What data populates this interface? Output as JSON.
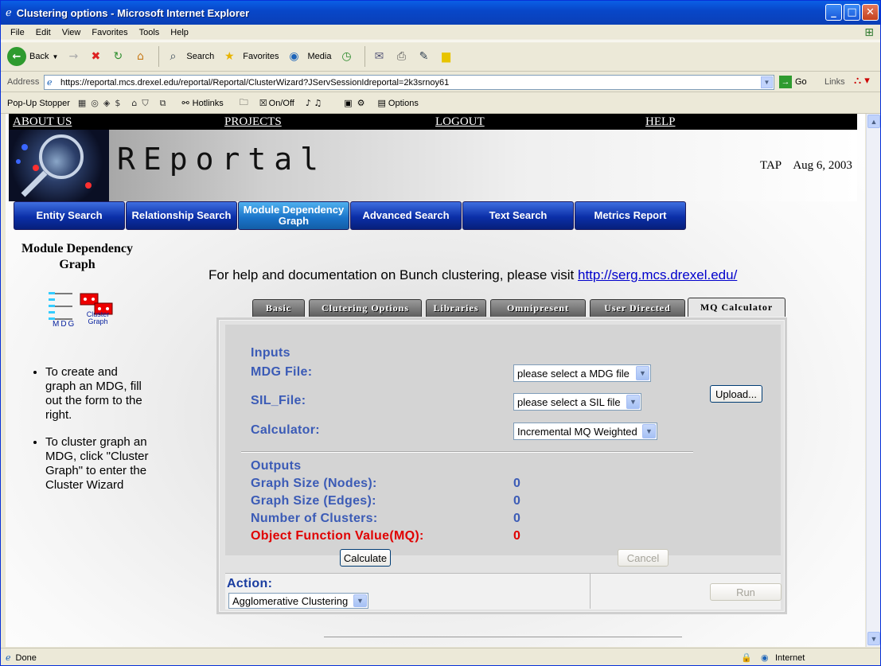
{
  "window": {
    "title": "Clustering options - Microsoft Internet Explorer",
    "controls": {
      "minimize": "_",
      "maximize": "□",
      "close": "✕"
    }
  },
  "menubar": {
    "items": [
      "File",
      "Edit",
      "View",
      "Favorites",
      "Tools",
      "Help"
    ]
  },
  "toolbar": {
    "back": "Back",
    "search": "Search",
    "favorites": "Favorites",
    "media": "Media"
  },
  "addressbar": {
    "label": "Address",
    "url": "https://reportal.mcs.drexel.edu/reportal/Reportal/ClusterWizard?JServSessionIdreportal=2k3srnoy61",
    "go": "Go",
    "links": "Links"
  },
  "popupbar": {
    "label": "Pop-Up Stopper",
    "hotlinks": "Hotlinks",
    "onoff": "On/Off",
    "options": "Options"
  },
  "page": {
    "topnav": [
      "ABOUT US",
      "PROJECTS",
      "LOGOUT",
      "HELP"
    ],
    "brand": "REportal",
    "user": "TAP",
    "date": "Aug 6, 2003",
    "nav_buttons": [
      "Entity Search",
      "Relationship Search",
      "Module Dependency Graph",
      "Advanced Search",
      "Text Search",
      "Metrics Report"
    ],
    "active_nav": "Module Dependency Graph",
    "sidebar": {
      "title": "Module Dependency Graph",
      "icon_labels": [
        "MDG",
        "Cluster Graph"
      ],
      "bullets": [
        "To create and graph an MDG, fill out the form to the right.",
        "To cluster graph an MDG, click \"Cluster Graph\" to enter the Cluster Wizard"
      ]
    },
    "help_text": "For help and documentation on Bunch clustering, please visit ",
    "help_link": "http://serg.mcs.drexel.edu/",
    "tabs": [
      "Basic",
      "Clutering Options",
      "Libraries",
      "Omnipresent",
      "User Directed",
      "MQ Calculator"
    ],
    "selected_tab": "MQ Calculator",
    "form": {
      "inputs_heading": "Inputs",
      "mdg_label": "MDG File:",
      "mdg_value": "please select a MDG file",
      "sil_label": "SIL_File:",
      "sil_value": "please select a SIL file",
      "upload": "Upload...",
      "calc_label": "Calculator:",
      "calc_value": "Incremental MQ Weighted",
      "outputs_heading": "Outputs",
      "outputs": [
        {
          "label": "Graph Size (Nodes):",
          "value": "0"
        },
        {
          "label": "Graph Size (Edges):",
          "value": "0"
        },
        {
          "label": "Number of Clusters:",
          "value": "0"
        },
        {
          "label": "Object Function Value(MQ):",
          "value": "0"
        }
      ],
      "calculate": "Calculate",
      "cancel": "Cancel",
      "action_label": "Action:",
      "action_value": "Agglomerative Clustering",
      "run": "Run"
    }
  },
  "statusbar": {
    "status": "Done",
    "zone": "Internet"
  }
}
